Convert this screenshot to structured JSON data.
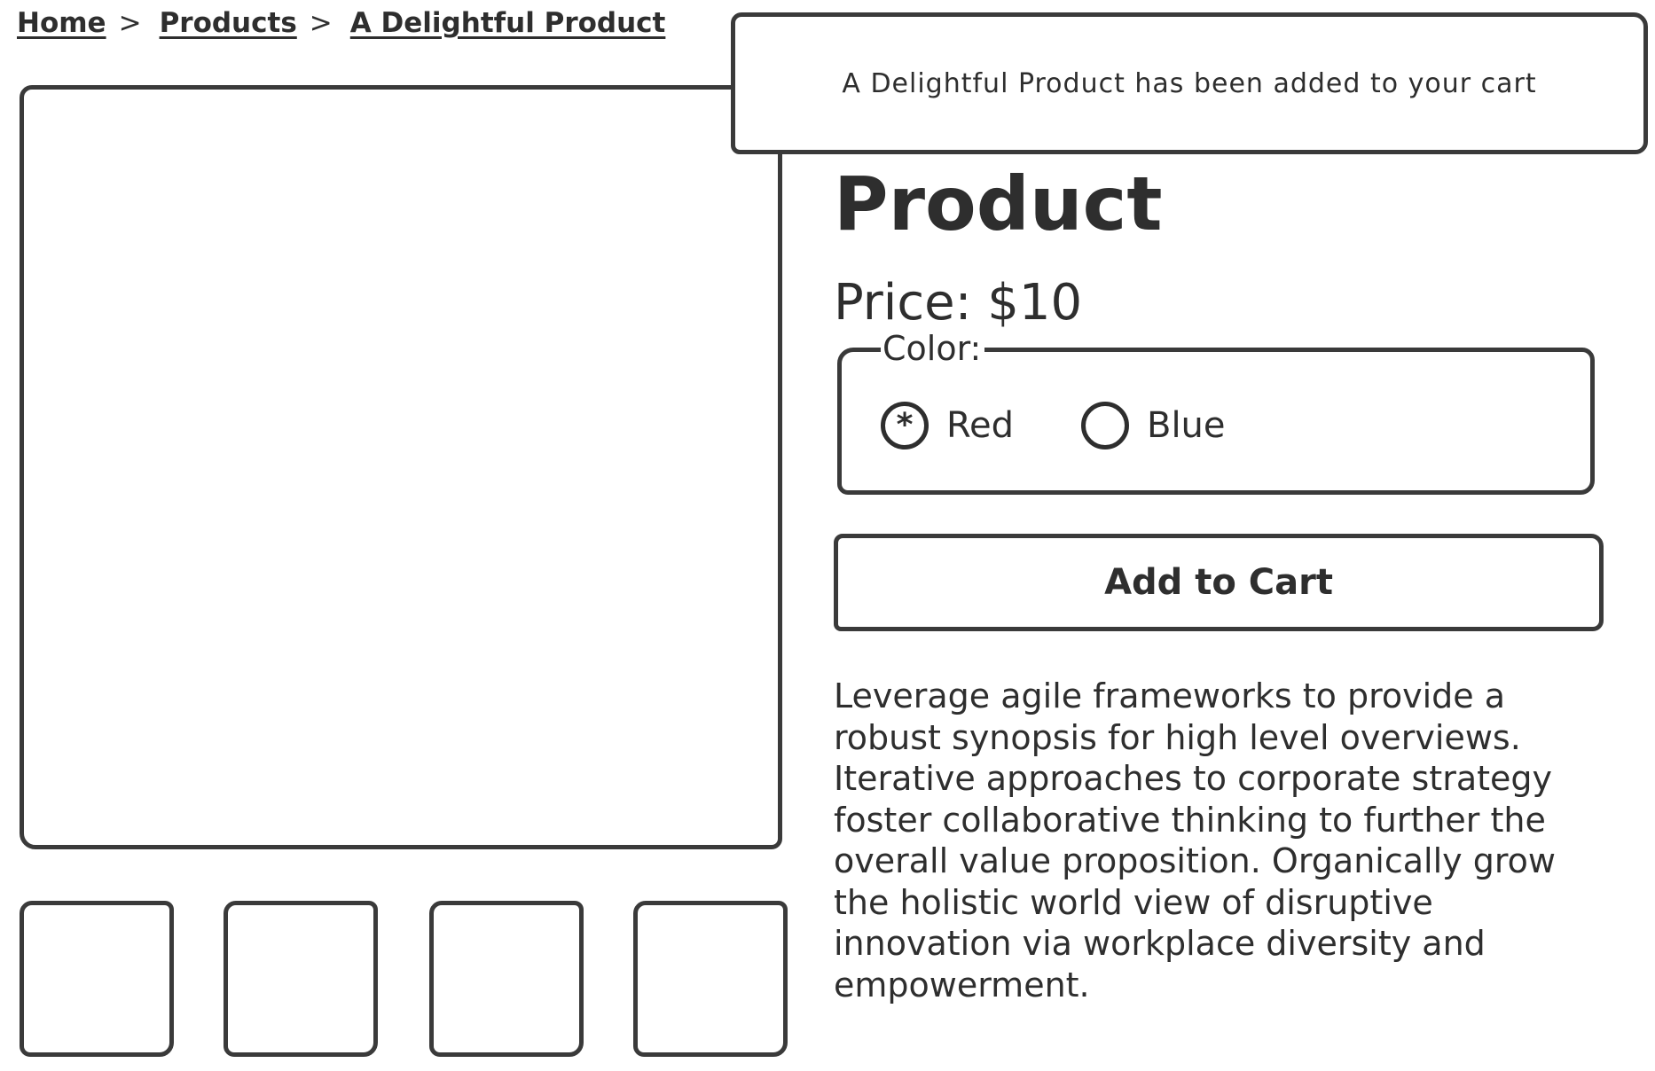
{
  "breadcrumb": {
    "items": [
      {
        "label": "Home"
      },
      {
        "label": "Products"
      },
      {
        "label": "A Delightful Product"
      }
    ],
    "separator": ">"
  },
  "product": {
    "title": "Product",
    "price": "Price: $10",
    "color": {
      "legend": "Color:",
      "options": [
        {
          "label": "Red",
          "selected": true,
          "mark": "*"
        },
        {
          "label": "Blue",
          "selected": false,
          "mark": ""
        }
      ]
    },
    "add_to_cart_label": "Add to Cart",
    "description": "Leverage agile frameworks to provide a robust synopsis for high level overviews. Iterative approaches to corporate strategy foster collaborative thinking to further the overall value proposition. Organically grow the holistic world view of disruptive innovation via workplace diversity and empowerment."
  },
  "toast": {
    "message": "A Delightful Product has been added to your cart"
  },
  "colors": {
    "stroke": "#3a3a3a",
    "text": "#2e2e2e",
    "background": "#ffffff"
  }
}
